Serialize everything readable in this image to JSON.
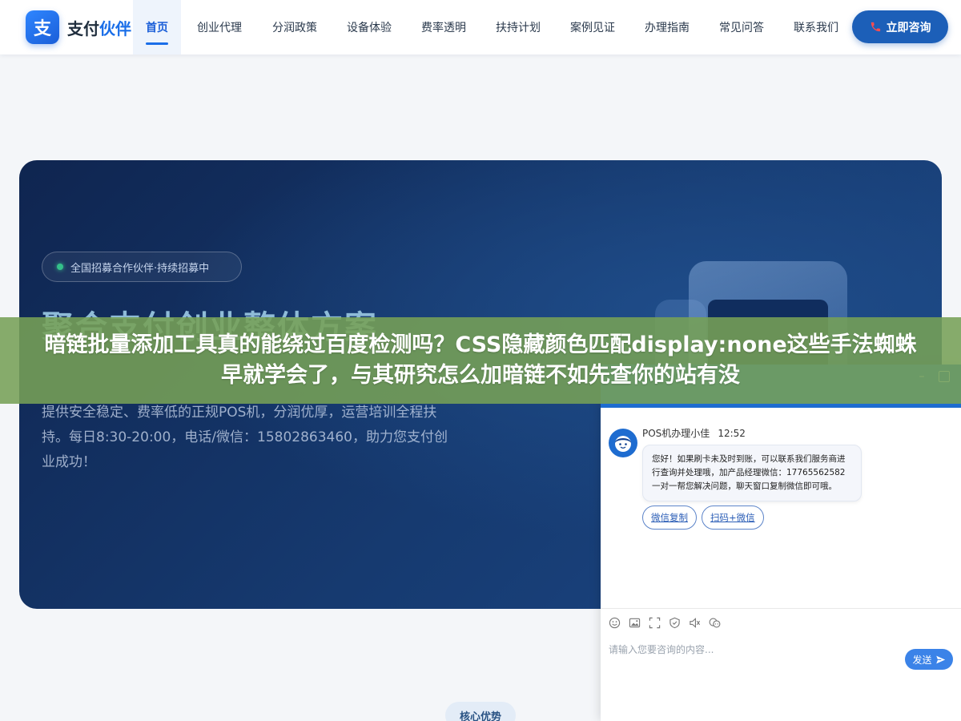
{
  "header": {
    "logo_badge": "支",
    "logo_text_main": "支付",
    "logo_text_accent": "伙伴",
    "nav": [
      {
        "label": "首页",
        "active": true
      },
      {
        "label": "创业代理",
        "active": false
      },
      {
        "label": "分润政策",
        "active": false
      },
      {
        "label": "设备体验",
        "active": false
      },
      {
        "label": "费率透明",
        "active": false
      },
      {
        "label": "扶持计划",
        "active": false
      },
      {
        "label": "案例见证",
        "active": false
      },
      {
        "label": "办理指南",
        "active": false
      },
      {
        "label": "常见问答",
        "active": false
      },
      {
        "label": "联系我们",
        "active": false
      }
    ],
    "consult_label": "立即咨询",
    "consult_icon": "phone-icon"
  },
  "hero": {
    "pill_text": "全国招募合作伙伴·持续招募中",
    "title": "聚合支付创业整体方案",
    "description": "提供安全稳定、费率低的正规POS机，分润优厚，运营培训全程扶持。每日8:30-20:00，电话/微信：15802863460，助力您支付创业成功！"
  },
  "banner": {
    "text": "暗链批量添加工具真的能绕过百度检测吗？CSS隐藏颜色匹配display:none这些手法蜘蛛早就学会了，与其研究怎么加暗链不如先查你的站有没"
  },
  "chat": {
    "minimize_icon": "minimize-icon",
    "maximize_icon": "maximize-icon",
    "agent_name": "POS机办理小佳",
    "time": "12:52",
    "message": "您好！如果刷卡未及时到账，可以联系我们服务商进行查询并处理哦，加产品经理微信：17765562582 一对一帮您解决问题，聊天窗口复制微信即可哦。",
    "actions": [
      "微信复制",
      "扫码+微信"
    ],
    "toolbar_icons": [
      "emoji-icon",
      "image-icon",
      "screenshot-icon",
      "rating-icon",
      "mute-icon",
      "transfer-icon"
    ],
    "input_placeholder": "请输入您要咨询的内容...",
    "send_label": "发送"
  },
  "section": {
    "tag": "核心优势"
  },
  "colors": {
    "brand": "#1a6ee8",
    "consult": "#1c5fb8",
    "hero_dark": "#0f2550",
    "banner": "#76a056",
    "chat_head": "#1e6cd0"
  }
}
